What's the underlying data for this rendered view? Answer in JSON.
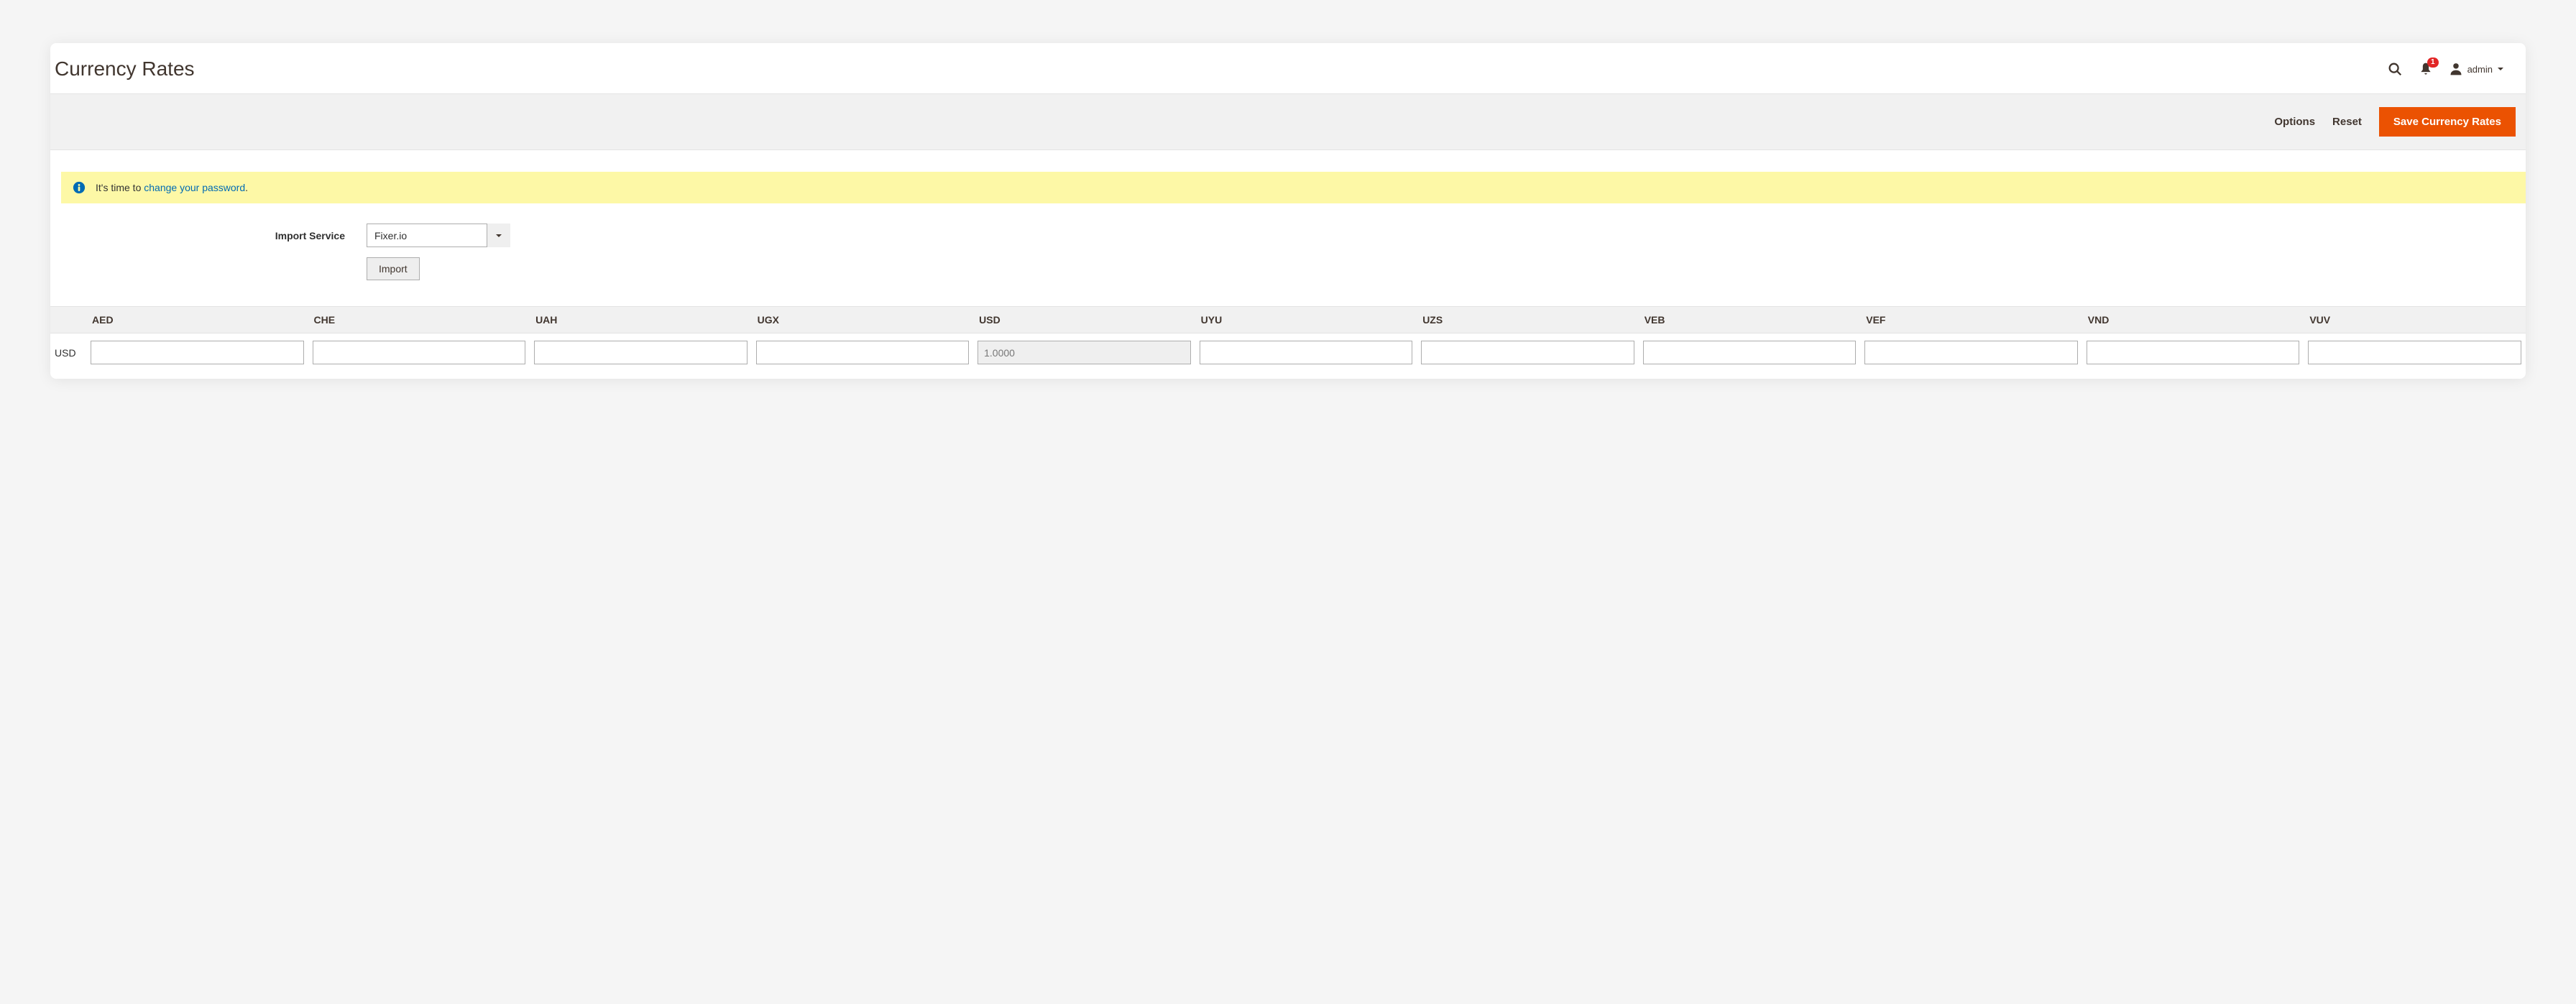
{
  "header": {
    "title": "Currency Rates",
    "notifications_count": "1",
    "user_name": "admin"
  },
  "actions": {
    "options": "Options",
    "reset": "Reset",
    "save": "Save Currency Rates"
  },
  "notice": {
    "prefix": "It's time to ",
    "link": "change your password",
    "suffix": "."
  },
  "import": {
    "label": "Import Service",
    "service": "Fixer.io",
    "button": "Import"
  },
  "rates": {
    "base_label": "USD",
    "columns": [
      "AED",
      "CHE",
      "UAH",
      "UGX",
      "USD",
      "UYU",
      "UZS",
      "VEB",
      "VEF",
      "VND",
      "VUV"
    ],
    "row": {
      "base": "USD",
      "values": {
        "AED": "",
        "CHE": "",
        "UAH": "",
        "UGX": "",
        "USD": "1.0000",
        "UYU": "",
        "UZS": "",
        "VEB": "",
        "VEF": "",
        "VND": "",
        "VUV": ""
      },
      "disabled": [
        "USD"
      ]
    }
  }
}
